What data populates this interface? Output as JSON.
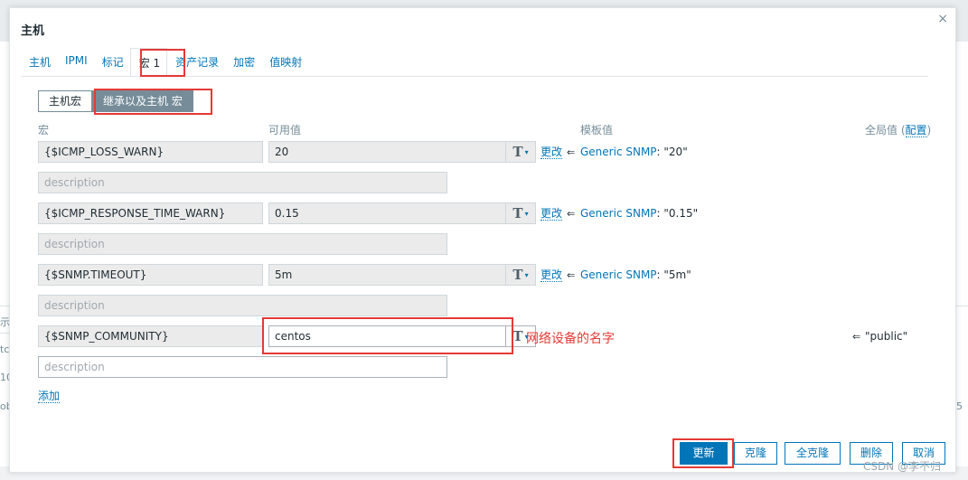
{
  "dialog": {
    "title": "主机",
    "close_icon": "×"
  },
  "tabs": [
    {
      "label": "主机"
    },
    {
      "label": "IPMI"
    },
    {
      "label": "标记"
    },
    {
      "label": "宏 1",
      "active": true
    },
    {
      "label": "资产记录"
    },
    {
      "label": "加密"
    },
    {
      "label": "值映射"
    }
  ],
  "segment": {
    "host_macros": "主机宏",
    "inherited_macros": "继承以及主机 宏"
  },
  "columns": {
    "macro": "宏",
    "value": "可用值",
    "template_value": "模板值",
    "global_value": "全局值 (",
    "global_config": "配置",
    "global_close": ")"
  },
  "macros": [
    {
      "name": "{$ICMP_LOSS_WARN}",
      "value": "20",
      "description": "description",
      "change": "更改",
      "arrow": "⇐",
      "template": "Generic SNMP",
      "template_value": ": \"20\""
    },
    {
      "name": "{$ICMP_RESPONSE_TIME_WARN}",
      "value": "0.15",
      "description": "description",
      "change": "更改",
      "arrow": "⇐",
      "template": "Generic SNMP",
      "template_value": ": \"0.15\""
    },
    {
      "name": "{$SNMP.TIMEOUT}",
      "value": "5m",
      "description": "description",
      "change": "更改",
      "arrow": "⇐",
      "template": "Generic SNMP",
      "template_value": ": \"5m\""
    },
    {
      "name": "{$SNMP_COMMUNITY}",
      "value": "centos",
      "description": "description",
      "arrow": "⇐",
      "global_value": "\"public\""
    }
  ],
  "annotation": "网络设备的名字",
  "add_label": "添加",
  "buttons": {
    "update": "更新",
    "clone": "克隆",
    "full_clone": "全克隆",
    "delete": "删除",
    "cancel": "取消"
  },
  "watermark": "CSDN @李不归",
  "background_fragments": {
    "left": [
      "示 ,",
      "tcl",
      "10",
      "obi"
    ],
    "right": [
      "5"
    ]
  },
  "colors": {
    "accent": "#0275b8",
    "highlight": "#e53935",
    "segment_active": "#768d99"
  }
}
